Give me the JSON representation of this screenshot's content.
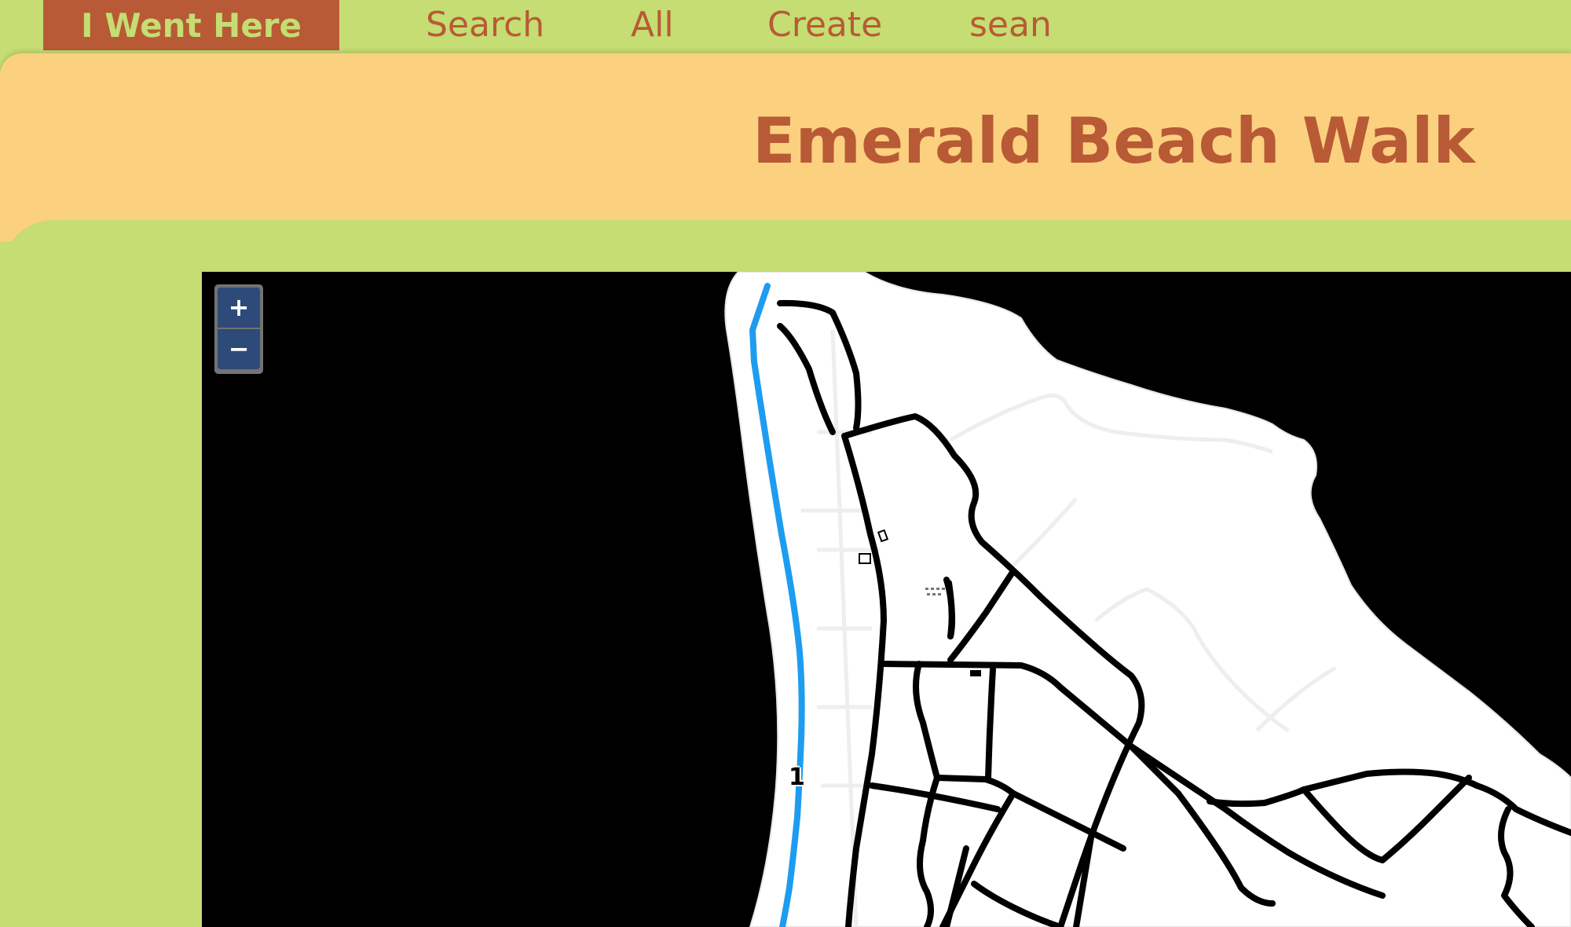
{
  "nav": {
    "brand": "I Went Here",
    "links": [
      "Search",
      "All",
      "Create",
      "sean"
    ]
  },
  "page": {
    "title": "Emerald Beach Walk"
  },
  "map": {
    "zoom_in": "+",
    "zoom_out": "−",
    "marker_label": "1",
    "route_color": "#1e9cf0"
  },
  "colors": {
    "nav_bg": "#c5dd72",
    "brand_bg": "#b85a36",
    "header_bg": "#fbd07f",
    "accent_text": "#b85a36"
  }
}
